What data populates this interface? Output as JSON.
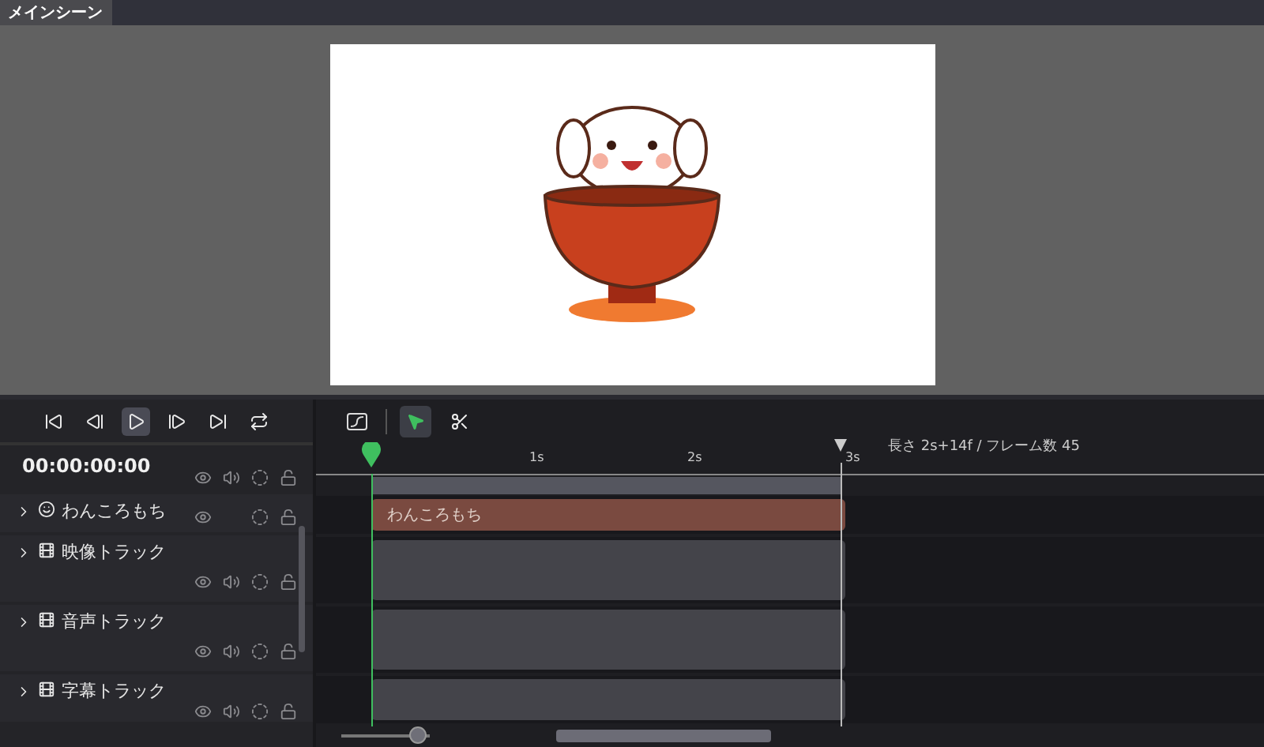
{
  "scene_tab": {
    "label": "メインシーン",
    "selected": true
  },
  "timecode": "00:00:00:00",
  "tools": [
    {
      "kind": "select",
      "selected": true
    },
    {
      "kind": "cut",
      "selected": false
    }
  ],
  "duration_info": "長さ 2s+14f / フレーム数 45",
  "ruler_labels": [
    "1s",
    "2s",
    "3s"
  ],
  "tracks": [
    {
      "kind": "object",
      "name": "わんころもち",
      "clip": "わんころもち"
    },
    {
      "kind": "video",
      "name": "映像トラック"
    },
    {
      "kind": "audio",
      "name": "音声トラック"
    },
    {
      "kind": "subtitle",
      "name": "字幕トラック"
    }
  ],
  "zoom": {
    "level": 0.85
  }
}
